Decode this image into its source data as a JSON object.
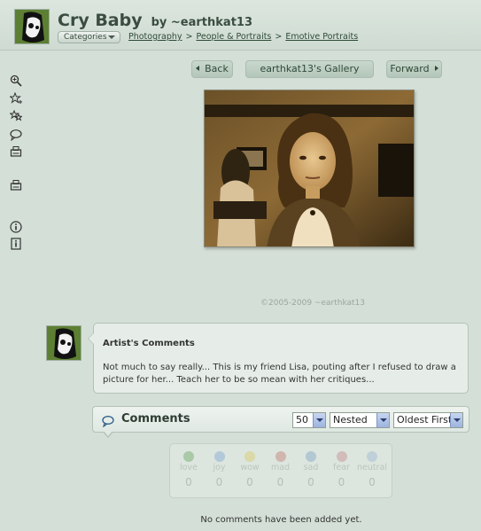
{
  "header": {
    "title": "Cry Baby",
    "by_line": "by ~earthkat13",
    "categories_button": "Categories",
    "breadcrumb": [
      "Photography",
      "People & Portraits",
      "Emotive Portraits"
    ],
    "breadcrumb_sep": ">"
  },
  "toolbar": {
    "icons": [
      "zoom-icon",
      "star-add-icon",
      "stars-icon",
      "comment-icon",
      "print-icon",
      "print2-icon",
      "info-icon",
      "details-icon"
    ]
  },
  "gallery_nav": {
    "back": "Back",
    "gallery": "earthkat13's Gallery",
    "forward": "Forward"
  },
  "copyright": "©2005-2009 ~earthkat13",
  "artist_comments": {
    "heading": "Artist's Comments",
    "text": "Not much to say really... This is my friend Lisa, pouting after I refused to draw a picture for her... Teach her to be so mean with her critiques..."
  },
  "comments": {
    "title": "Comments",
    "per_page": "50",
    "mode": "Nested",
    "order": "Oldest First",
    "empty_message": "No comments have been added yet."
  },
  "moods": [
    {
      "label": "love",
      "count": "0",
      "color": "#7fb27a"
    },
    {
      "label": "joy",
      "count": "0",
      "color": "#8fb3d6"
    },
    {
      "label": "wow",
      "count": "0",
      "color": "#d9d07a"
    },
    {
      "label": "mad",
      "count": "0",
      "color": "#c98f86"
    },
    {
      "label": "sad",
      "count": "0",
      "color": "#8fb0c9"
    },
    {
      "label": "fear",
      "count": "0",
      "color": "#c99a9a"
    },
    {
      "label": "neutral",
      "count": "0",
      "color": "#a9bfd6"
    }
  ],
  "colors": {
    "background": "#d4dfd7",
    "accent": "#2e4a36"
  }
}
